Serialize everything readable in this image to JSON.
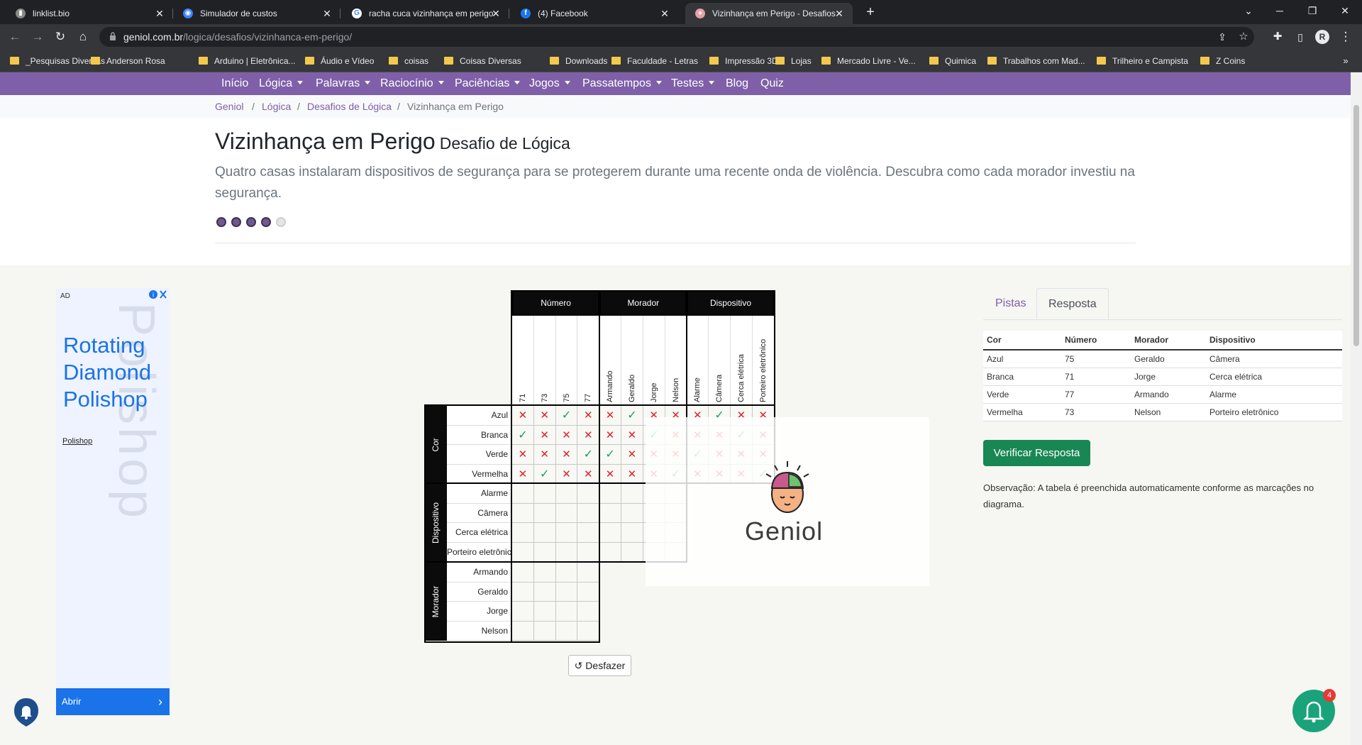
{
  "browser": {
    "tabs": [
      {
        "title": "linklist.bio",
        "icon": "linklist-icon"
      },
      {
        "title": "Simulador de custos",
        "icon": "simulador-icon"
      },
      {
        "title": "racha cuca vizinhança em perigo",
        "icon": "google-icon"
      },
      {
        "title": "(4) Facebook",
        "icon": "facebook-icon"
      },
      {
        "title": "Vizinhança em Perigo - Desafios",
        "icon": "geniol-icon"
      }
    ],
    "url_host": "geniol.com.br",
    "url_path": "/logica/desafios/vizinhanca-em-perigo/",
    "bookmarks": [
      "_Pesquisas Diversas",
      "Anderson Rosa",
      "Arduino | Eletrônica...",
      "Áudio e Vídeo",
      "coisas",
      "Coisas Diversas",
      "Downloads",
      "Faculdade - Letras",
      "Impressão 3D",
      "Lojas",
      "Mercado Livre - Ve...",
      "Quimica",
      "Trabalhos com Mad...",
      "Trilheiro e Campista",
      "Z Coins"
    ]
  },
  "nav": [
    "Início",
    "Lógica",
    "Palavras",
    "Raciocínio",
    "Paciências",
    "Jogos",
    "Passatempos",
    "Testes",
    "Blog",
    "Quiz"
  ],
  "nav_dropdown": [
    false,
    true,
    true,
    true,
    true,
    true,
    true,
    true,
    false,
    false
  ],
  "breadcrumb": [
    "Geniol",
    "Lógica",
    "Desafios de Lógica",
    "Vizinhança em Perigo"
  ],
  "page": {
    "title": "Vizinhança em Perigo",
    "subtitle": "Desafio de Lógica",
    "description": "Quatro casas instalaram dispositivos de segurança para se protegerem durante uma recente onda de violência. Descubra como cada morador investiu na segurança.",
    "difficulty": 4,
    "difficulty_max": 5
  },
  "ad": {
    "label": "AD",
    "title": "Rotating Diamond Polishop",
    "watermark": "Polishop",
    "brand": "Polishop",
    "cta": "Abrir"
  },
  "grid": {
    "col_groups": [
      "Número",
      "Morador",
      "Dispositivo"
    ],
    "col_labels": [
      [
        "71",
        "73",
        "75",
        "77"
      ],
      [
        "Armando",
        "Geraldo",
        "Jorge",
        "Nelson"
      ],
      [
        "Alarme",
        "Câmera",
        "Cerca elétrica",
        "Porteiro eletrônico"
      ]
    ],
    "row_groups": [
      "Cor",
      "Dispositivo",
      "Morador"
    ],
    "row_labels": [
      [
        "Azul",
        "Branca",
        "Verde",
        "Vermelha"
      ],
      [
        "Alarme",
        "Câmera",
        "Cerca elétrica",
        "Porteiro eletrônico"
      ],
      [
        "Armando",
        "Geraldo",
        "Jorge",
        "Nelson"
      ]
    ],
    "cells_cor": [
      [
        "x",
        "x",
        "v",
        "x",
        "x",
        "v",
        "x",
        "x",
        "x",
        "v",
        "x",
        "x"
      ],
      [
        "v",
        "x",
        "x",
        "x",
        "x",
        "x",
        "v",
        "x",
        "x",
        "x",
        "v",
        "x"
      ],
      [
        "x",
        "x",
        "x",
        "v",
        "v",
        "x",
        "x",
        "x",
        "v",
        "x",
        "x",
        "x"
      ],
      [
        "x",
        "v",
        "x",
        "x",
        "x",
        "x",
        "x",
        "v",
        "x",
        "x",
        "x",
        "v"
      ]
    ],
    "logo": "Geniol",
    "undo_label": "Desfazer"
  },
  "right_panel": {
    "tabs": [
      "Pistas",
      "Resposta"
    ],
    "active_tab": "Resposta",
    "table_headers": [
      "Cor",
      "Número",
      "Morador",
      "Dispositivo"
    ],
    "table_rows": [
      [
        "Azul",
        "75",
        "Geraldo",
        "Câmera"
      ],
      [
        "Branca",
        "71",
        "Jorge",
        "Cerca elétrica"
      ],
      [
        "Verde",
        "77",
        "Armando",
        "Alarme"
      ],
      [
        "Vermelha",
        "73",
        "Nelson",
        "Porteiro eletrônico"
      ]
    ],
    "verify_label": "Verificar Resposta",
    "observation": "Observação: A tabela é preenchida automaticamente conforme as marcações no diagrama."
  },
  "notifications": {
    "count": "4"
  },
  "colors": {
    "nav_bg": "#7f5fa8",
    "verify": "#198754",
    "check": "#1e9e57",
    "cross": "#d9242f",
    "bell": "#1aa37a"
  }
}
